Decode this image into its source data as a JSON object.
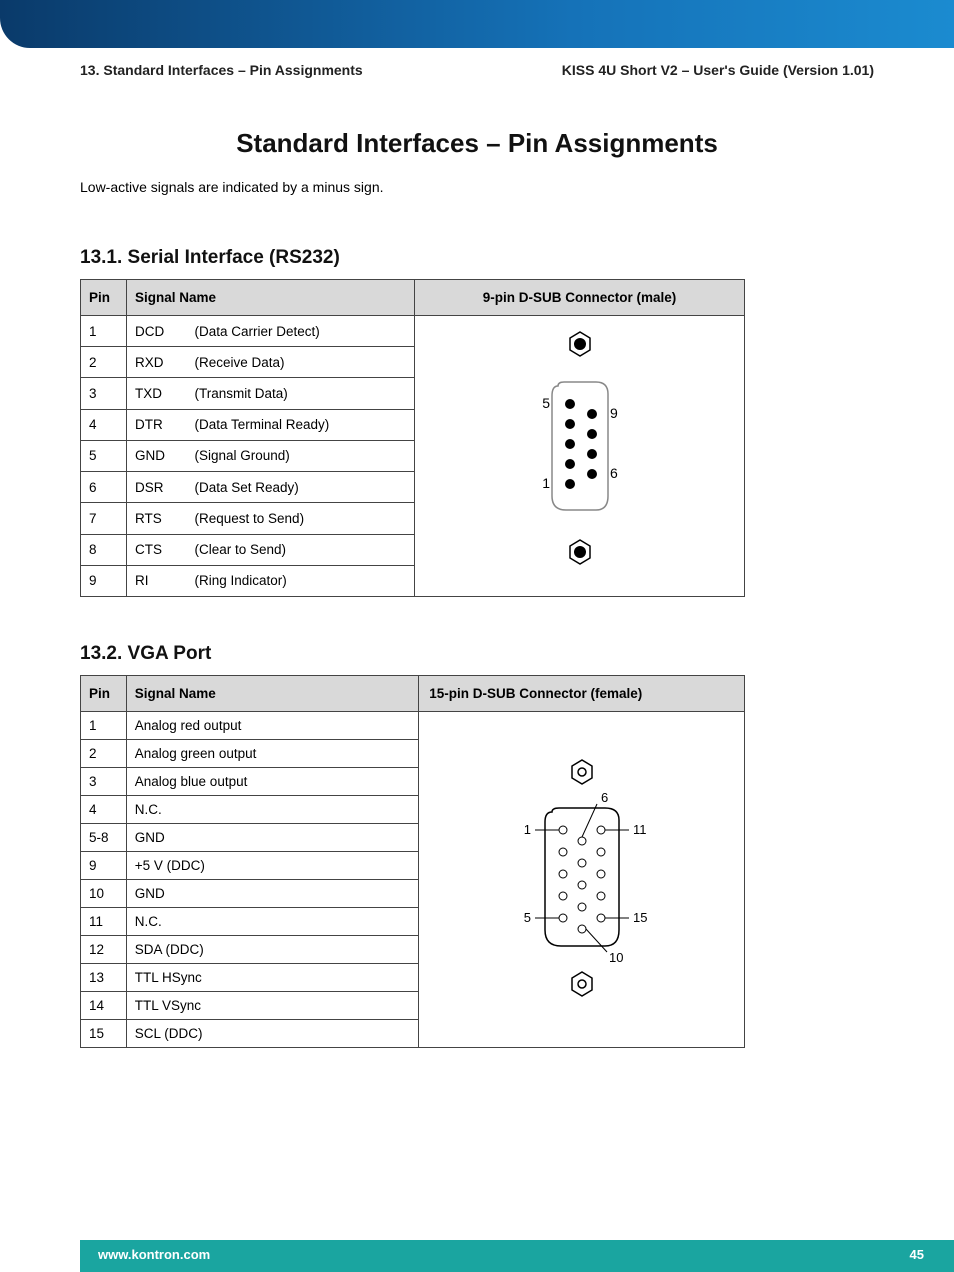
{
  "header": {
    "left": "13. Standard Interfaces – Pin Assignments",
    "right": "KISS 4U Short V2 – User's Guide (Version 1.01)"
  },
  "title": "Standard Interfaces – Pin Assignments",
  "intro": "Low-active signals are indicated by a minus sign.",
  "section1": {
    "heading": "13.1. Serial Interface (RS232)",
    "col_pin": "Pin",
    "col_signal": "Signal Name",
    "col_diag": "9-pin D-SUB Connector (male)",
    "rows": [
      {
        "pin": "1",
        "abbr": "DCD",
        "desc": "(Data Carrier Detect)"
      },
      {
        "pin": "2",
        "abbr": "RXD",
        "desc": "(Receive Data)"
      },
      {
        "pin": "3",
        "abbr": "TXD",
        "desc": "(Transmit Data)"
      },
      {
        "pin": "4",
        "abbr": "DTR",
        "desc": "(Data Terminal Ready)"
      },
      {
        "pin": "5",
        "abbr": "GND",
        "desc": "(Signal Ground)"
      },
      {
        "pin": "6",
        "abbr": "DSR",
        "desc": "(Data Set Ready)"
      },
      {
        "pin": "7",
        "abbr": "RTS",
        "desc": "(Request to Send)"
      },
      {
        "pin": "8",
        "abbr": "CTS",
        "desc": "(Clear to Send)"
      },
      {
        "pin": "9",
        "abbr": "RI",
        "desc": "(Ring Indicator)"
      }
    ],
    "labels": {
      "l1": "1",
      "l5": "5",
      "l6": "6",
      "l9": "9"
    }
  },
  "section2": {
    "heading": "13.2. VGA Port",
    "col_pin": "Pin",
    "col_signal": "Signal Name",
    "col_diag": "15-pin D-SUB Connector (female)",
    "rows": [
      {
        "pin": "1",
        "name": "Analog red output"
      },
      {
        "pin": "2",
        "name": "Analog green output"
      },
      {
        "pin": "3",
        "name": "Analog blue output"
      },
      {
        "pin": "4",
        "name": "N.C."
      },
      {
        "pin": "5-8",
        "name": "GND"
      },
      {
        "pin": "9",
        "name": "+5 V (DDC)"
      },
      {
        "pin": "10",
        "name": "GND"
      },
      {
        "pin": "11",
        "name": "N.C."
      },
      {
        "pin": "12",
        "name": "SDA (DDC)"
      },
      {
        "pin": "13",
        "name": "TTL HSync"
      },
      {
        "pin": "14",
        "name": "TTL VSync"
      },
      {
        "pin": "15",
        "name": "SCL (DDC)"
      }
    ],
    "labels": {
      "l1": "1",
      "l5": "5",
      "l6": "6",
      "l10": "10",
      "l11": "11",
      "l15": "15"
    }
  },
  "footer": {
    "url": "www.kontron.com",
    "page": "45"
  }
}
